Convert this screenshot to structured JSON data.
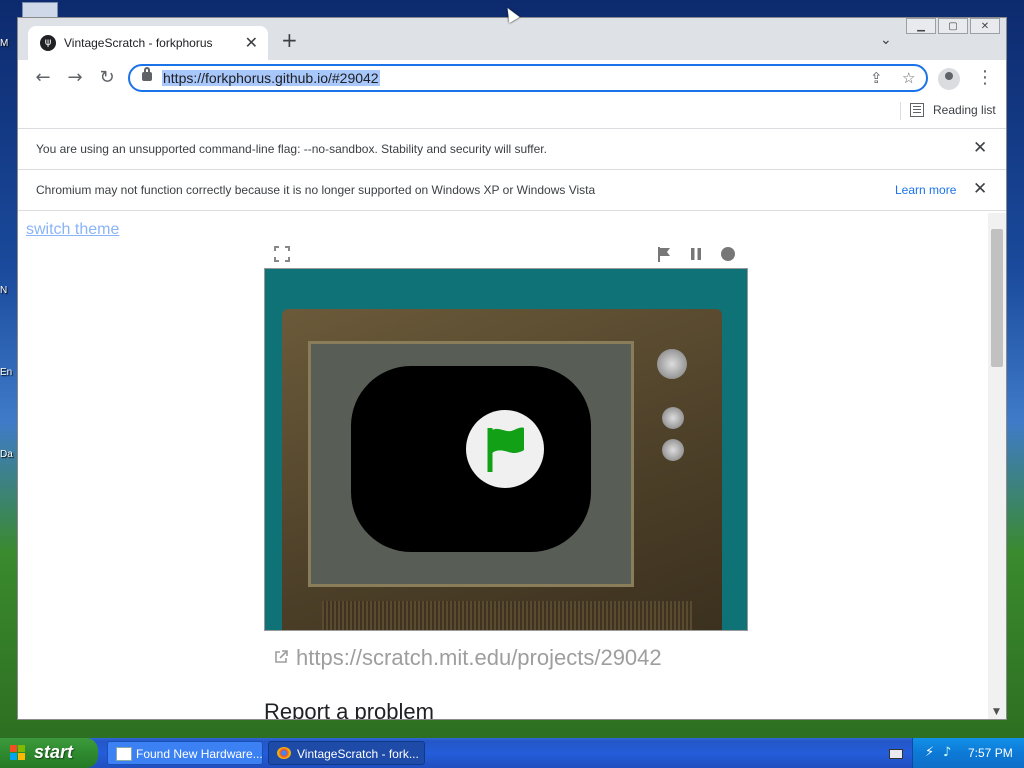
{
  "desktop": {
    "labels": [
      "M",
      "N",
      "En",
      "Da"
    ]
  },
  "browser": {
    "tab": {
      "title": "VintageScratch - forkphorus",
      "favicon": "forkphorus-icon"
    },
    "window_buttons": [
      "minimize",
      "maximize",
      "close"
    ],
    "address": {
      "url": "https://forkphorus.github.io/#29042"
    },
    "reading_list_label": "Reading list",
    "infobars": [
      {
        "message": "You are using an unsupported command-line flag: --no-sandbox. Stability and security will suffer."
      },
      {
        "message": "Chromium may not function correctly because it is no longer supported on Windows XP or Windows Vista",
        "link": "Learn more"
      }
    ]
  },
  "page": {
    "switch_theme": "switch theme",
    "project_link": "https://scratch.mit.edu/projects/29042",
    "report_heading": "Report a problem",
    "controls": [
      "fullscreen-icon",
      "green-flag-icon",
      "pause-icon",
      "stop-icon"
    ],
    "colors": {
      "stage_bg": "#0e7277",
      "flag_green": "#12a016",
      "link_blue": "#8ab4f8"
    }
  },
  "taskbar": {
    "start_label": "start",
    "tasks": [
      {
        "label": "Found New Hardware..."
      },
      {
        "label": "VintageScratch - fork..."
      }
    ],
    "clock": "7:57 PM"
  }
}
